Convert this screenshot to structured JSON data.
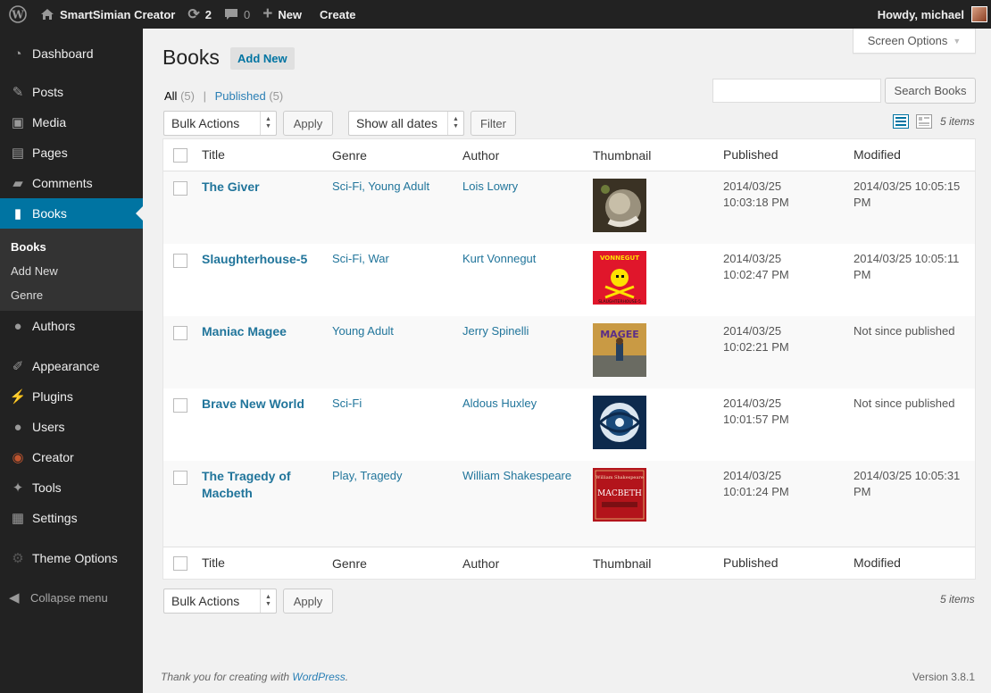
{
  "adminbar": {
    "site_name": "SmartSimian Creator",
    "updates_count": "2",
    "comments_count": "0",
    "new_label": "New",
    "create_label": "Create",
    "howdy": "Howdy, michael"
  },
  "sidebar": {
    "items": [
      {
        "label": "Dashboard"
      },
      {
        "label": "Posts"
      },
      {
        "label": "Media"
      },
      {
        "label": "Pages"
      },
      {
        "label": "Comments"
      },
      {
        "label": "Books"
      },
      {
        "label": "Authors"
      },
      {
        "label": "Appearance"
      },
      {
        "label": "Plugins"
      },
      {
        "label": "Users"
      },
      {
        "label": "Creator"
      },
      {
        "label": "Tools"
      },
      {
        "label": "Settings"
      },
      {
        "label": "Theme Options"
      }
    ],
    "submenu": [
      "Books",
      "Add New",
      "Genre"
    ],
    "collapse": "Collapse menu"
  },
  "screen_options": "Screen Options",
  "page": {
    "title": "Books",
    "add_new": "Add New"
  },
  "filters": {
    "all": "All",
    "all_count": "(5)",
    "sep": "|",
    "published": "Published",
    "published_count": "(5)"
  },
  "search": {
    "button": "Search Books",
    "placeholder": ""
  },
  "toolbar": {
    "bulk_actions": "Bulk Actions",
    "apply": "Apply",
    "dates": "Show all dates",
    "filter": "Filter",
    "items": "5 items"
  },
  "table": {
    "columns": [
      "Title",
      "Genre",
      "Author",
      "Thumbnail",
      "Published",
      "Modified"
    ],
    "rows": [
      {
        "title": "The Giver",
        "genre": "Sci-Fi, Young Adult",
        "author": "Lois Lowry",
        "published_date": "2014/03/25",
        "published_time": "10:03:18 PM",
        "modified_1": "2014/03/25 10:05:15",
        "modified_2": "PM"
      },
      {
        "title": "Slaughterhouse-5",
        "genre": "Sci-Fi, War",
        "author": "Kurt Vonnegut",
        "published_date": "2014/03/25",
        "published_time": "10:02:47 PM",
        "modified_1": "2014/03/25 10:05:11",
        "modified_2": "PM"
      },
      {
        "title": "Maniac Magee",
        "genre": "Young Adult",
        "author": "Jerry Spinelli",
        "published_date": "2014/03/25",
        "published_time": "10:02:21 PM",
        "modified_1": "Not since published",
        "modified_2": ""
      },
      {
        "title": "Brave New World",
        "genre": "Sci-Fi",
        "author": "Aldous Huxley",
        "published_date": "2014/03/25",
        "published_time": "10:01:57 PM",
        "modified_1": "Not since published",
        "modified_2": ""
      },
      {
        "title_1": "The Tragedy of",
        "title_2": "Macbeth",
        "genre": "Play, Tragedy",
        "author": "William Shakespeare",
        "published_date": "2014/03/25",
        "published_time": "10:01:24 PM",
        "modified_1": "2014/03/25 10:05:31",
        "modified_2": "PM"
      }
    ],
    "thumbnails": {
      "giver_label": "",
      "slaughter_label": "VONNEGUT",
      "slaughter_sub": "SLAUGHTERHOUSE-5",
      "magee_label": "MAGEE",
      "macbeth_top": "William Shakespeare",
      "macbeth_title": "MACBETH"
    }
  },
  "footer": {
    "thanks_prefix": "Thank you for creating with ",
    "wordpress": "WordPress",
    "thanks_suffix": ".",
    "version": "Version 3.8.1"
  },
  "colors": {
    "sidebar_bg": "#222222",
    "current_menu": "#0074a2",
    "link": "#21759b"
  }
}
